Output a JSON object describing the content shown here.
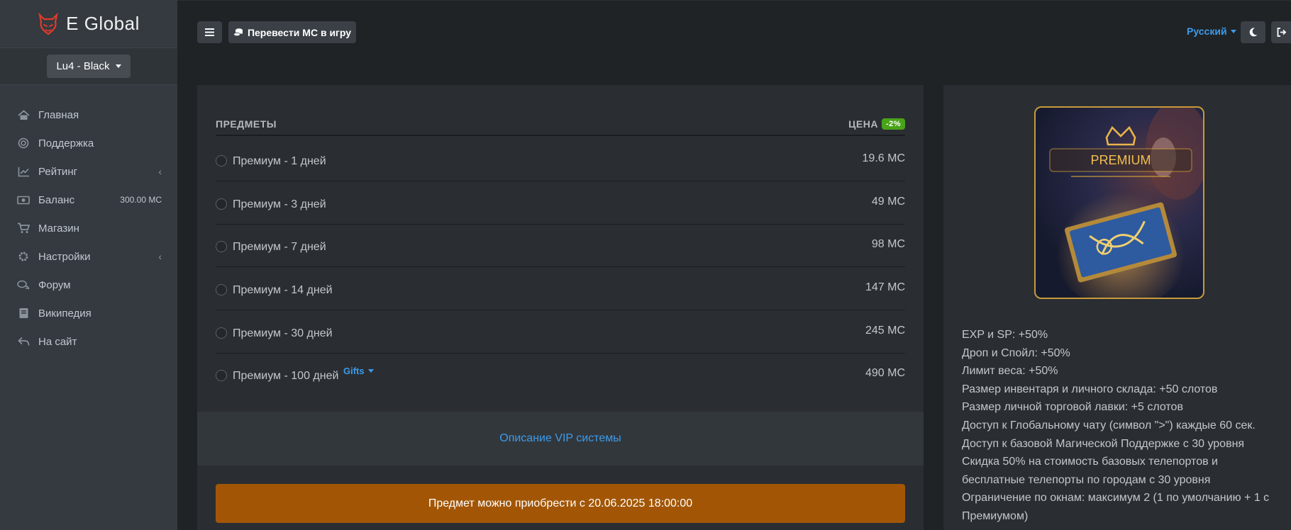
{
  "brand": {
    "name": "E Global"
  },
  "server": {
    "label": "Lu4 - Black"
  },
  "sidebar": {
    "items": [
      {
        "label": "Главная",
        "icon": "home-icon"
      },
      {
        "label": "Поддержка",
        "icon": "lifebuoy-icon"
      },
      {
        "label": "Рейтинг",
        "icon": "chart-line-icon",
        "extra": "‹"
      },
      {
        "label": "Баланс",
        "icon": "money-icon",
        "extra": "300.00 MC"
      },
      {
        "label": "Магазин",
        "icon": "cart-icon"
      },
      {
        "label": "Настройки",
        "icon": "gear-icon",
        "extra": "‹"
      },
      {
        "label": "Форум",
        "icon": "comments-icon"
      },
      {
        "label": "Википедия",
        "icon": "book-icon"
      },
      {
        "label": "На сайт",
        "icon": "reply-icon"
      }
    ]
  },
  "topbar": {
    "transfer_label": "Перевести MC в игру",
    "language": "Русский"
  },
  "table": {
    "col_items": "ПРЕДМЕТЫ",
    "col_price": "ЦЕНА",
    "discount": "-2%",
    "rows": [
      {
        "label": "Премиум - 1 дней",
        "price": "19.6 MC"
      },
      {
        "label": "Премиум - 3 дней",
        "price": "49 MC"
      },
      {
        "label": "Премиум - 7 дней",
        "price": "98 MC"
      },
      {
        "label": "Премиум - 14 дней",
        "price": "147 MC"
      },
      {
        "label": "Премиум - 30 дней",
        "price": "245 MC"
      },
      {
        "label": "Премиум - 100 дней",
        "price": "490 MC",
        "gifts": "Gifts"
      }
    ]
  },
  "vip_link": "Описание VIP системы",
  "buy_notice": "Предмет можно приобрести с 20.06.2025 18:00:00",
  "premium": {
    "badge": "PREMIUM",
    "benefits": [
      "EXP и SP: +50%",
      "Дроп и Спойл: +50%",
      "Лимит веса: +50%",
      "Размер инвентаря и личного склада: +50 слотов",
      "Размер личной торговой лавки: +5 слотов",
      "Доступ к Глобальному чату (символ \">\") каждые 60 сек.",
      "Доступ к базовой Магической Поддержке с 30 уровня",
      "Скидка 50% на стоимость базовых телепортов и бесплатные телепорты по городам с 30 уровня",
      "Ограничение по окнам: максимум 2 (1 по умолчанию + 1 с Премиумом)"
    ]
  },
  "colors": {
    "accent": "#3d9be9",
    "discount": "#49a319",
    "notice": "#a25605",
    "sidebar": "#343a40"
  }
}
